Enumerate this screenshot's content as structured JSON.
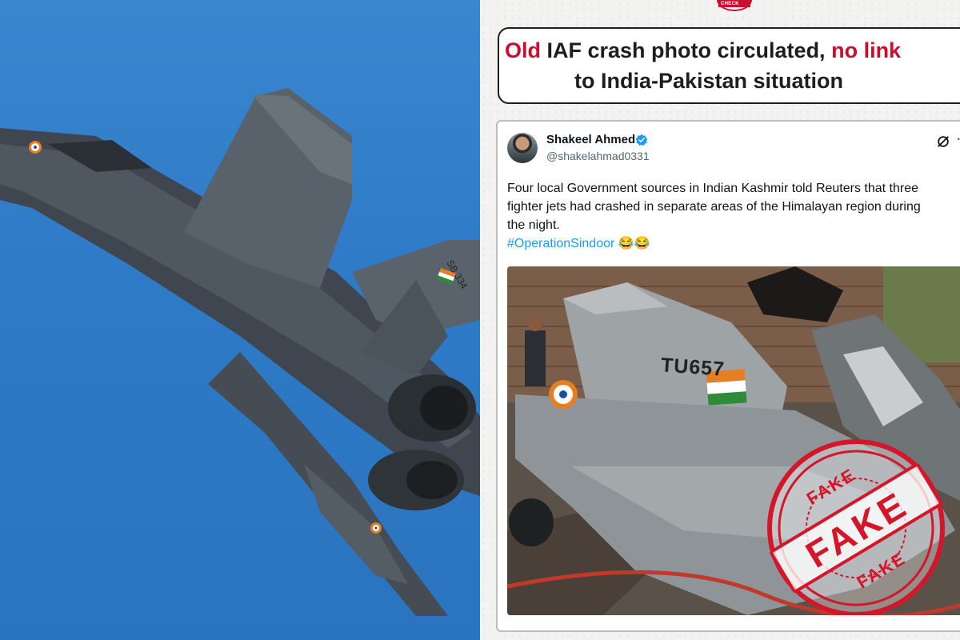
{
  "left_photo": {
    "description_icon": "fighter-jet-photo",
    "aircraft_serial": "SB 334"
  },
  "logo": {
    "tag_text": "FACT CHECK"
  },
  "headline": {
    "line1_part1": "Old",
    "line1_part2": " IAF crash photo circulated, ",
    "line1_part3": "no link",
    "line2": "to India-Pakistan situation"
  },
  "tweet": {
    "display_name": "Shakeel Ahmed",
    "handle": "@shakelahmad0331",
    "text_line1": "Four local Government sources in Indian Kashmir told Reuters that three",
    "text_line2": "fighter jets had crashed in separate areas of the Himalayan region during",
    "text_line3": "the night.",
    "hashtag": "#OperationSindoor",
    "emoji": "😂😂",
    "more_label": "·",
    "media": {
      "tail_number": "TU657"
    }
  },
  "stamp": {
    "top": "FAKE",
    "main": "FAKE",
    "bottom": "FAKE"
  },
  "colors": {
    "accent_red": "#c8102e",
    "link_blue": "#1d9bf0",
    "sky_blue": "#2f7bc7"
  }
}
